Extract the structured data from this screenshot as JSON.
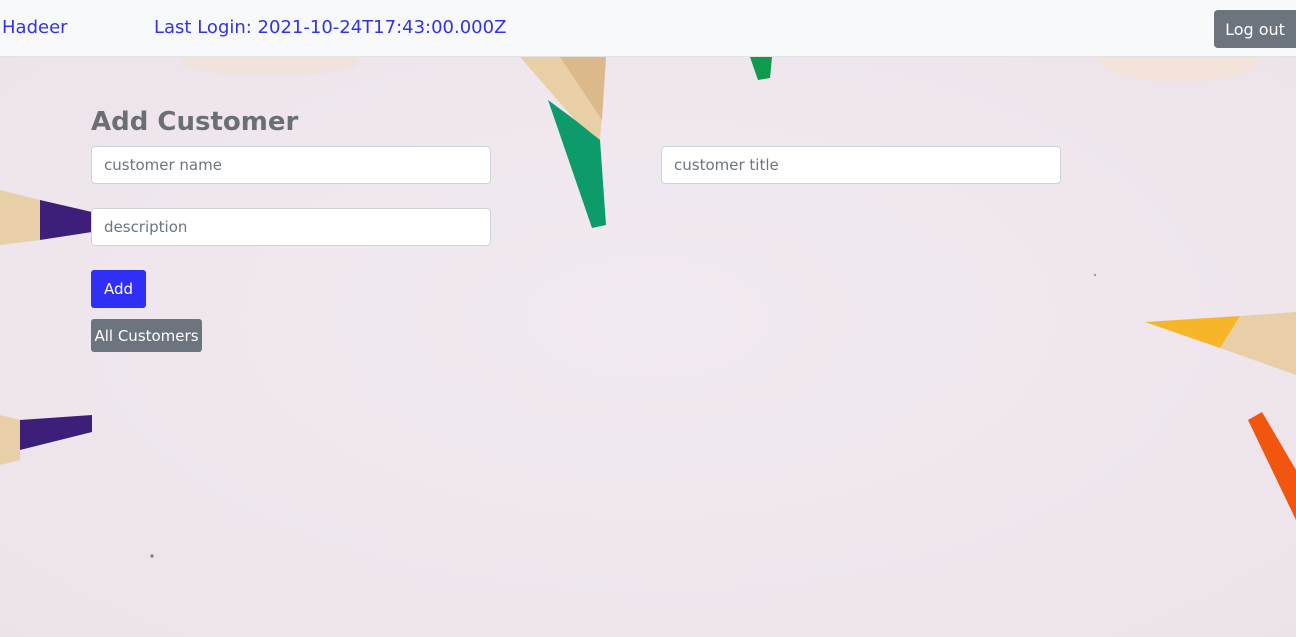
{
  "navbar": {
    "brand": "Hadeer",
    "last_login": "Last Login: 2021-10-24T17:43:00.000Z",
    "logout_label": "Log out"
  },
  "form": {
    "title": "Add Customer",
    "name_placeholder": "customer name",
    "title_placeholder": "customer title",
    "description_placeholder": "description",
    "add_label": "Add",
    "all_customers_label": "All Customers"
  },
  "colors": {
    "link": "#3232e6",
    "primary": "#2f2ff5",
    "secondary": "#6c757d",
    "navbar_bg": "#f8f9fa",
    "page_bg": "#f1e9f1"
  },
  "icons": {
    "background": "colored-pencils-background"
  }
}
